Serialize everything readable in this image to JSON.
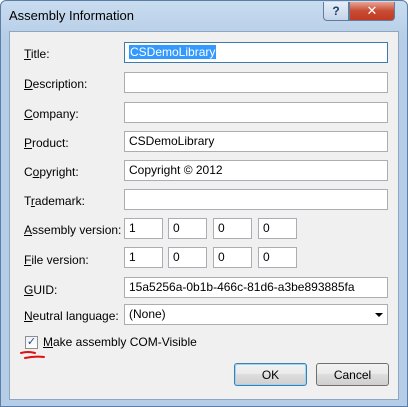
{
  "window": {
    "title": "Assembly Information",
    "help": "?",
    "close": "✕"
  },
  "labels": {
    "title": {
      "mn": "T",
      "rest": "itle:"
    },
    "description": {
      "mn": "D",
      "rest": "escription:"
    },
    "company": {
      "mn": "C",
      "rest": "ompany:"
    },
    "product": {
      "mn": "P",
      "rest": "roduct:"
    },
    "copyright": {
      "pre": "C",
      "mn": "o",
      "rest": "pyright:"
    },
    "trademark": {
      "pre": "T",
      "mn": "r",
      "rest": "ademark:"
    },
    "assembly_version": {
      "mn": "A",
      "rest": "ssembly version:"
    },
    "file_version": {
      "mn": "F",
      "rest": "ile version:"
    },
    "guid": {
      "mn": "G",
      "rest": "UID:"
    },
    "neutral_language": {
      "mn": "N",
      "rest": "eutral language:"
    },
    "com_visible": {
      "mn": "M",
      "rest": "ake assembly COM-Visible"
    }
  },
  "fields": {
    "title": "CSDemoLibrary",
    "description": "",
    "company": "",
    "product": "CSDemoLibrary",
    "copyright": "Copyright ©  2012",
    "trademark": "",
    "assembly_version": [
      "1",
      "0",
      "0",
      "0"
    ],
    "file_version": [
      "1",
      "0",
      "0",
      "0"
    ],
    "guid": "15a5256a-0b1b-466c-81d6-a3be893885fa",
    "neutral_language": "(None)"
  },
  "com_visible_checked": true,
  "buttons": {
    "ok": "OK",
    "cancel": "Cancel"
  }
}
